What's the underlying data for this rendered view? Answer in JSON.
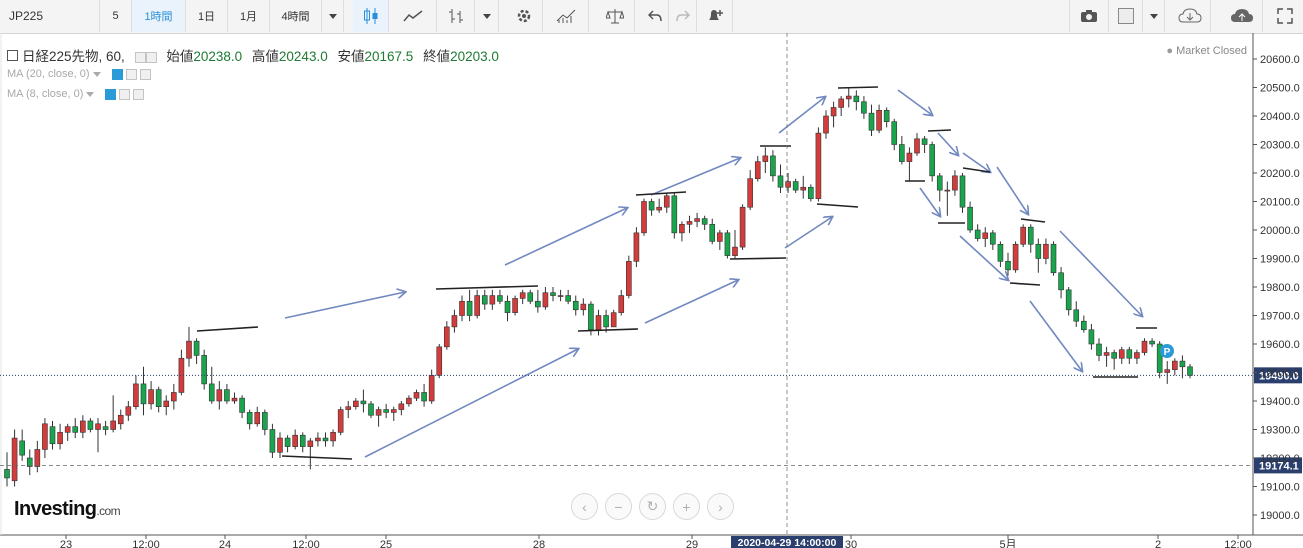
{
  "toolbar": {
    "symbol": "JP225",
    "interval_input": "5",
    "intervals": [
      "1時間",
      "1日",
      "1月",
      "4時間"
    ],
    "active_interval": "1時間",
    "icons": [
      "dropdown-icon",
      "candles-icon",
      "area-chart-icon",
      "bars-icon",
      "dropdown-icon",
      "settings-icon",
      "indicators-icon",
      "compare-icon",
      "undo-icon",
      "redo-icon",
      "alert-icon",
      "camera-icon",
      "color-swatch-icon",
      "dropdown-icon",
      "cloud-download-icon",
      "cloud-upload-icon",
      "fullscreen-icon"
    ]
  },
  "legend": {
    "title": "日経225先物, 60,",
    "open_label": "始値",
    "open": "20238.0",
    "high_label": "高値",
    "high": "20243.0",
    "low_label": "安値",
    "low": "20167.5",
    "close_label": "終値",
    "close": "20203.0",
    "ma1": "MA (20, close, 0)",
    "ma2": "MA (8, close, 0)"
  },
  "market_status": "Market Closed",
  "logo": {
    "name": "Investing",
    "suffix": ".com"
  },
  "colors": {
    "up": "#d43b3b",
    "down": "#1aa44e",
    "annotation_arrow": "#7189c0",
    "annotation_line": "#222222",
    "price_label_bg": "#2a3f6e",
    "price_label_text": "#ffffff"
  },
  "chart_data": {
    "type": "candlestick",
    "ylim": [
      18930,
      20650
    ],
    "y_ticks": [
      "20600.0",
      "20500.0",
      "20400.0",
      "20300.0",
      "20200.0",
      "20100.0",
      "20000.0",
      "19900.0",
      "19800.0",
      "19700.0",
      "19600.0",
      "19500.0",
      "19400.0",
      "19300.0",
      "19200.0",
      "19100.0",
      "19000.0"
    ],
    "x_ticks": [
      "23",
      "12:00",
      "24",
      "12:00",
      "25",
      "28",
      "29",
      "2020-04-29 14:00:00",
      "30",
      "5月",
      "2",
      "12:00"
    ],
    "current_price": "19490.0",
    "reference_price": "19174.1",
    "crosshair_label": "2020-04-29 14:00:00",
    "marker_label": "P",
    "candles": [
      {
        "o": 19160,
        "h": 19220,
        "l": 19100,
        "c": 19130
      },
      {
        "o": 19120,
        "h": 19300,
        "l": 19100,
        "c": 19270
      },
      {
        "o": 19260,
        "h": 19300,
        "l": 19190,
        "c": 19210
      },
      {
        "o": 19200,
        "h": 19230,
        "l": 19140,
        "c": 19170
      },
      {
        "o": 19170,
        "h": 19260,
        "l": 19150,
        "c": 19230
      },
      {
        "o": 19230,
        "h": 19340,
        "l": 19200,
        "c": 19320
      },
      {
        "o": 19310,
        "h": 19330,
        "l": 19230,
        "c": 19250
      },
      {
        "o": 19250,
        "h": 19320,
        "l": 19230,
        "c": 19290
      },
      {
        "o": 19290,
        "h": 19320,
        "l": 19260,
        "c": 19310
      },
      {
        "o": 19310,
        "h": 19340,
        "l": 19270,
        "c": 19290
      },
      {
        "o": 19290,
        "h": 19350,
        "l": 19270,
        "c": 19330
      },
      {
        "o": 19330,
        "h": 19340,
        "l": 19290,
        "c": 19300
      },
      {
        "o": 19300,
        "h": 19340,
        "l": 19220,
        "c": 19320
      },
      {
        "o": 19310,
        "h": 19330,
        "l": 19280,
        "c": 19300
      },
      {
        "o": 19300,
        "h": 19420,
        "l": 19290,
        "c": 19330
      },
      {
        "o": 19320,
        "h": 19370,
        "l": 19300,
        "c": 19350
      },
      {
        "o": 19350,
        "h": 19400,
        "l": 19330,
        "c": 19380
      },
      {
        "o": 19380,
        "h": 19490,
        "l": 19370,
        "c": 19460
      },
      {
        "o": 19460,
        "h": 19520,
        "l": 19350,
        "c": 19390
      },
      {
        "o": 19390,
        "h": 19470,
        "l": 19370,
        "c": 19440
      },
      {
        "o": 19440,
        "h": 19450,
        "l": 19360,
        "c": 19380
      },
      {
        "o": 19380,
        "h": 19420,
        "l": 19350,
        "c": 19400
      },
      {
        "o": 19400,
        "h": 19460,
        "l": 19370,
        "c": 19430
      },
      {
        "o": 19430,
        "h": 19580,
        "l": 19420,
        "c": 19550
      },
      {
        "o": 19550,
        "h": 19660,
        "l": 19520,
        "c": 19610
      },
      {
        "o": 19610,
        "h": 19620,
        "l": 19530,
        "c": 19560
      },
      {
        "o": 19560,
        "h": 19580,
        "l": 19440,
        "c": 19460
      },
      {
        "o": 19460,
        "h": 19520,
        "l": 19390,
        "c": 19400
      },
      {
        "o": 19400,
        "h": 19470,
        "l": 19370,
        "c": 19440
      },
      {
        "o": 19440,
        "h": 19460,
        "l": 19390,
        "c": 19400
      },
      {
        "o": 19400,
        "h": 19430,
        "l": 19390,
        "c": 19410
      },
      {
        "o": 19410,
        "h": 19420,
        "l": 19340,
        "c": 19360
      },
      {
        "o": 19360,
        "h": 19370,
        "l": 19300,
        "c": 19320
      },
      {
        "o": 19320,
        "h": 19380,
        "l": 19310,
        "c": 19360
      },
      {
        "o": 19360,
        "h": 19370,
        "l": 19280,
        "c": 19300
      },
      {
        "o": 19300,
        "h": 19320,
        "l": 19200,
        "c": 19220
      },
      {
        "o": 19220,
        "h": 19290,
        "l": 19200,
        "c": 19270
      },
      {
        "o": 19270,
        "h": 19280,
        "l": 19220,
        "c": 19240
      },
      {
        "o": 19240,
        "h": 19300,
        "l": 19230,
        "c": 19280
      },
      {
        "o": 19280,
        "h": 19290,
        "l": 19220,
        "c": 19240
      },
      {
        "o": 19240,
        "h": 19270,
        "l": 19160,
        "c": 19260
      },
      {
        "o": 19260,
        "h": 19290,
        "l": 19240,
        "c": 19270
      },
      {
        "o": 19270,
        "h": 19290,
        "l": 19240,
        "c": 19260
      },
      {
        "o": 19260,
        "h": 19300,
        "l": 19240,
        "c": 19290
      },
      {
        "o": 19290,
        "h": 19380,
        "l": 19280,
        "c": 19370
      },
      {
        "o": 19370,
        "h": 19400,
        "l": 19340,
        "c": 19380
      },
      {
        "o": 19380,
        "h": 19410,
        "l": 19370,
        "c": 19400
      },
      {
        "o": 19400,
        "h": 19440,
        "l": 19360,
        "c": 19390
      },
      {
        "o": 19390,
        "h": 19400,
        "l": 19340,
        "c": 19350
      },
      {
        "o": 19350,
        "h": 19380,
        "l": 19310,
        "c": 19370
      },
      {
        "o": 19370,
        "h": 19390,
        "l": 19340,
        "c": 19360
      },
      {
        "o": 19360,
        "h": 19380,
        "l": 19330,
        "c": 19370
      },
      {
        "o": 19370,
        "h": 19400,
        "l": 19350,
        "c": 19390
      },
      {
        "o": 19390,
        "h": 19420,
        "l": 19380,
        "c": 19410
      },
      {
        "o": 19410,
        "h": 19440,
        "l": 19400,
        "c": 19430
      },
      {
        "o": 19430,
        "h": 19460,
        "l": 19380,
        "c": 19400
      },
      {
        "o": 19400,
        "h": 19510,
        "l": 19390,
        "c": 19490
      },
      {
        "o": 19490,
        "h": 19600,
        "l": 19480,
        "c": 19590
      },
      {
        "o": 19590,
        "h": 19680,
        "l": 19580,
        "c": 19660
      },
      {
        "o": 19660,
        "h": 19720,
        "l": 19640,
        "c": 19700
      },
      {
        "o": 19700,
        "h": 19770,
        "l": 19680,
        "c": 19750
      },
      {
        "o": 19750,
        "h": 19790,
        "l": 19680,
        "c": 19700
      },
      {
        "o": 19700,
        "h": 19790,
        "l": 19690,
        "c": 19770
      },
      {
        "o": 19770,
        "h": 19790,
        "l": 19720,
        "c": 19740
      },
      {
        "o": 19740,
        "h": 19790,
        "l": 19720,
        "c": 19770
      },
      {
        "o": 19770,
        "h": 19790,
        "l": 19740,
        "c": 19750
      },
      {
        "o": 19750,
        "h": 19770,
        "l": 19680,
        "c": 19710
      },
      {
        "o": 19710,
        "h": 19770,
        "l": 19700,
        "c": 19760
      },
      {
        "o": 19760,
        "h": 19790,
        "l": 19740,
        "c": 19780
      },
      {
        "o": 19780,
        "h": 19790,
        "l": 19740,
        "c": 19750
      },
      {
        "o": 19750,
        "h": 19790,
        "l": 19710,
        "c": 19730
      },
      {
        "o": 19730,
        "h": 19800,
        "l": 19720,
        "c": 19780
      },
      {
        "o": 19780,
        "h": 19800,
        "l": 19750,
        "c": 19770
      },
      {
        "o": 19770,
        "h": 19790,
        "l": 19750,
        "c": 19770
      },
      {
        "o": 19770,
        "h": 19790,
        "l": 19740,
        "c": 19750
      },
      {
        "o": 19750,
        "h": 19770,
        "l": 19700,
        "c": 19720
      },
      {
        "o": 19720,
        "h": 19760,
        "l": 19700,
        "c": 19740
      },
      {
        "o": 19740,
        "h": 19750,
        "l": 19630,
        "c": 19650
      },
      {
        "o": 19650,
        "h": 19720,
        "l": 19630,
        "c": 19700
      },
      {
        "o": 19700,
        "h": 19720,
        "l": 19640,
        "c": 19660
      },
      {
        "o": 19660,
        "h": 19720,
        "l": 19660,
        "c": 19710
      },
      {
        "o": 19710,
        "h": 19790,
        "l": 19700,
        "c": 19770
      },
      {
        "o": 19770,
        "h": 19910,
        "l": 19760,
        "c": 19890
      },
      {
        "o": 19890,
        "h": 20010,
        "l": 19870,
        "c": 19990
      },
      {
        "o": 19990,
        "h": 20110,
        "l": 19980,
        "c": 20100
      },
      {
        "o": 20100,
        "h": 20110,
        "l": 20050,
        "c": 20070
      },
      {
        "o": 20070,
        "h": 20110,
        "l": 20060,
        "c": 20080
      },
      {
        "o": 20080,
        "h": 20130,
        "l": 20060,
        "c": 20120
      },
      {
        "o": 20120,
        "h": 20130,
        "l": 19970,
        "c": 19990
      },
      {
        "o": 19990,
        "h": 20030,
        "l": 19960,
        "c": 20020
      },
      {
        "o": 20020,
        "h": 20050,
        "l": 19990,
        "c": 20030
      },
      {
        "o": 20030,
        "h": 20060,
        "l": 20010,
        "c": 20040
      },
      {
        "o": 20040,
        "h": 20050,
        "l": 20000,
        "c": 20020
      },
      {
        "o": 20020,
        "h": 20040,
        "l": 19950,
        "c": 19960
      },
      {
        "o": 19960,
        "h": 20000,
        "l": 19930,
        "c": 19990
      },
      {
        "o": 19990,
        "h": 20000,
        "l": 19900,
        "c": 19910
      },
      {
        "o": 19910,
        "h": 20000,
        "l": 19900,
        "c": 19940
      },
      {
        "o": 19940,
        "h": 20090,
        "l": 19930,
        "c": 20080
      },
      {
        "o": 20080,
        "h": 20210,
        "l": 20070,
        "c": 20180
      },
      {
        "o": 20180,
        "h": 20260,
        "l": 20170,
        "c": 20240
      },
      {
        "o": 20240,
        "h": 20290,
        "l": 20200,
        "c": 20260
      },
      {
        "o": 20260,
        "h": 20280,
        "l": 20170,
        "c": 20190
      },
      {
        "o": 20190,
        "h": 20230,
        "l": 20130,
        "c": 20150
      },
      {
        "o": 20150,
        "h": 20200,
        "l": 20130,
        "c": 20170
      },
      {
        "o": 20170,
        "h": 20180,
        "l": 20130,
        "c": 20140
      },
      {
        "o": 20140,
        "h": 20190,
        "l": 20110,
        "c": 20150
      },
      {
        "o": 20150,
        "h": 20160,
        "l": 20100,
        "c": 20110
      },
      {
        "o": 20110,
        "h": 20360,
        "l": 20100,
        "c": 20340
      },
      {
        "o": 20340,
        "h": 20420,
        "l": 20320,
        "c": 20400
      },
      {
        "o": 20400,
        "h": 20450,
        "l": 20360,
        "c": 20430
      },
      {
        "o": 20430,
        "h": 20470,
        "l": 20400,
        "c": 20460
      },
      {
        "o": 20460,
        "h": 20500,
        "l": 20430,
        "c": 20470
      },
      {
        "o": 20470,
        "h": 20490,
        "l": 20420,
        "c": 20450
      },
      {
        "o": 20450,
        "h": 20470,
        "l": 20390,
        "c": 20410
      },
      {
        "o": 20410,
        "h": 20440,
        "l": 20330,
        "c": 20350
      },
      {
        "o": 20350,
        "h": 20440,
        "l": 20340,
        "c": 20420
      },
      {
        "o": 20420,
        "h": 20430,
        "l": 20360,
        "c": 20380
      },
      {
        "o": 20380,
        "h": 20390,
        "l": 20280,
        "c": 20300
      },
      {
        "o": 20300,
        "h": 20330,
        "l": 20230,
        "c": 20240
      },
      {
        "o": 20240,
        "h": 20290,
        "l": 20170,
        "c": 20270
      },
      {
        "o": 20270,
        "h": 20340,
        "l": 20260,
        "c": 20320
      },
      {
        "o": 20320,
        "h": 20330,
        "l": 20270,
        "c": 20300
      },
      {
        "o": 20300,
        "h": 20310,
        "l": 20170,
        "c": 20190
      },
      {
        "o": 20190,
        "h": 20200,
        "l": 20100,
        "c": 20140
      },
      {
        "o": 20140,
        "h": 20170,
        "l": 20050,
        "c": 20140
      },
      {
        "o": 20140,
        "h": 20210,
        "l": 20120,
        "c": 20190
      },
      {
        "o": 20190,
        "h": 20200,
        "l": 20060,
        "c": 20080
      },
      {
        "o": 20080,
        "h": 20100,
        "l": 19990,
        "c": 20000
      },
      {
        "o": 20000,
        "h": 20020,
        "l": 19960,
        "c": 19970
      },
      {
        "o": 19970,
        "h": 20010,
        "l": 19940,
        "c": 19990
      },
      {
        "o": 19990,
        "h": 20000,
        "l": 19930,
        "c": 19950
      },
      {
        "o": 19950,
        "h": 19960,
        "l": 19870,
        "c": 19890
      },
      {
        "o": 19890,
        "h": 19920,
        "l": 19840,
        "c": 19860
      },
      {
        "o": 19860,
        "h": 19960,
        "l": 19850,
        "c": 19950
      },
      {
        "o": 19950,
        "h": 20020,
        "l": 19940,
        "c": 20010
      },
      {
        "o": 20010,
        "h": 20020,
        "l": 19920,
        "c": 19950
      },
      {
        "o": 19950,
        "h": 19970,
        "l": 19850,
        "c": 19900
      },
      {
        "o": 19900,
        "h": 19970,
        "l": 19880,
        "c": 19950
      },
      {
        "o": 19950,
        "h": 19960,
        "l": 19840,
        "c": 19850
      },
      {
        "o": 19850,
        "h": 19870,
        "l": 19760,
        "c": 19790
      },
      {
        "o": 19790,
        "h": 19800,
        "l": 19700,
        "c": 19720
      },
      {
        "o": 19720,
        "h": 19750,
        "l": 19660,
        "c": 19680
      },
      {
        "o": 19680,
        "h": 19700,
        "l": 19640,
        "c": 19650
      },
      {
        "o": 19650,
        "h": 19670,
        "l": 19580,
        "c": 19600
      },
      {
        "o": 19600,
        "h": 19620,
        "l": 19540,
        "c": 19560
      },
      {
        "o": 19560,
        "h": 19590,
        "l": 19520,
        "c": 19570
      },
      {
        "o": 19570,
        "h": 19580,
        "l": 19510,
        "c": 19550
      },
      {
        "o": 19550,
        "h": 19590,
        "l": 19530,
        "c": 19580
      },
      {
        "o": 19580,
        "h": 19590,
        "l": 19530,
        "c": 19550
      },
      {
        "o": 19550,
        "h": 19580,
        "l": 19530,
        "c": 19570
      },
      {
        "o": 19570,
        "h": 19620,
        "l": 19560,
        "c": 19610
      },
      {
        "o": 19610,
        "h": 19620,
        "l": 19590,
        "c": 19600
      },
      {
        "o": 19600,
        "h": 19610,
        "l": 19480,
        "c": 19500
      },
      {
        "o": 19500,
        "h": 19540,
        "l": 19460,
        "c": 19510
      },
      {
        "o": 19510,
        "h": 19550,
        "l": 19490,
        "c": 19540
      },
      {
        "o": 19540,
        "h": 19560,
        "l": 19480,
        "c": 19520
      },
      {
        "o": 19520,
        "h": 19530,
        "l": 19480,
        "c": 19490
      }
    ]
  }
}
